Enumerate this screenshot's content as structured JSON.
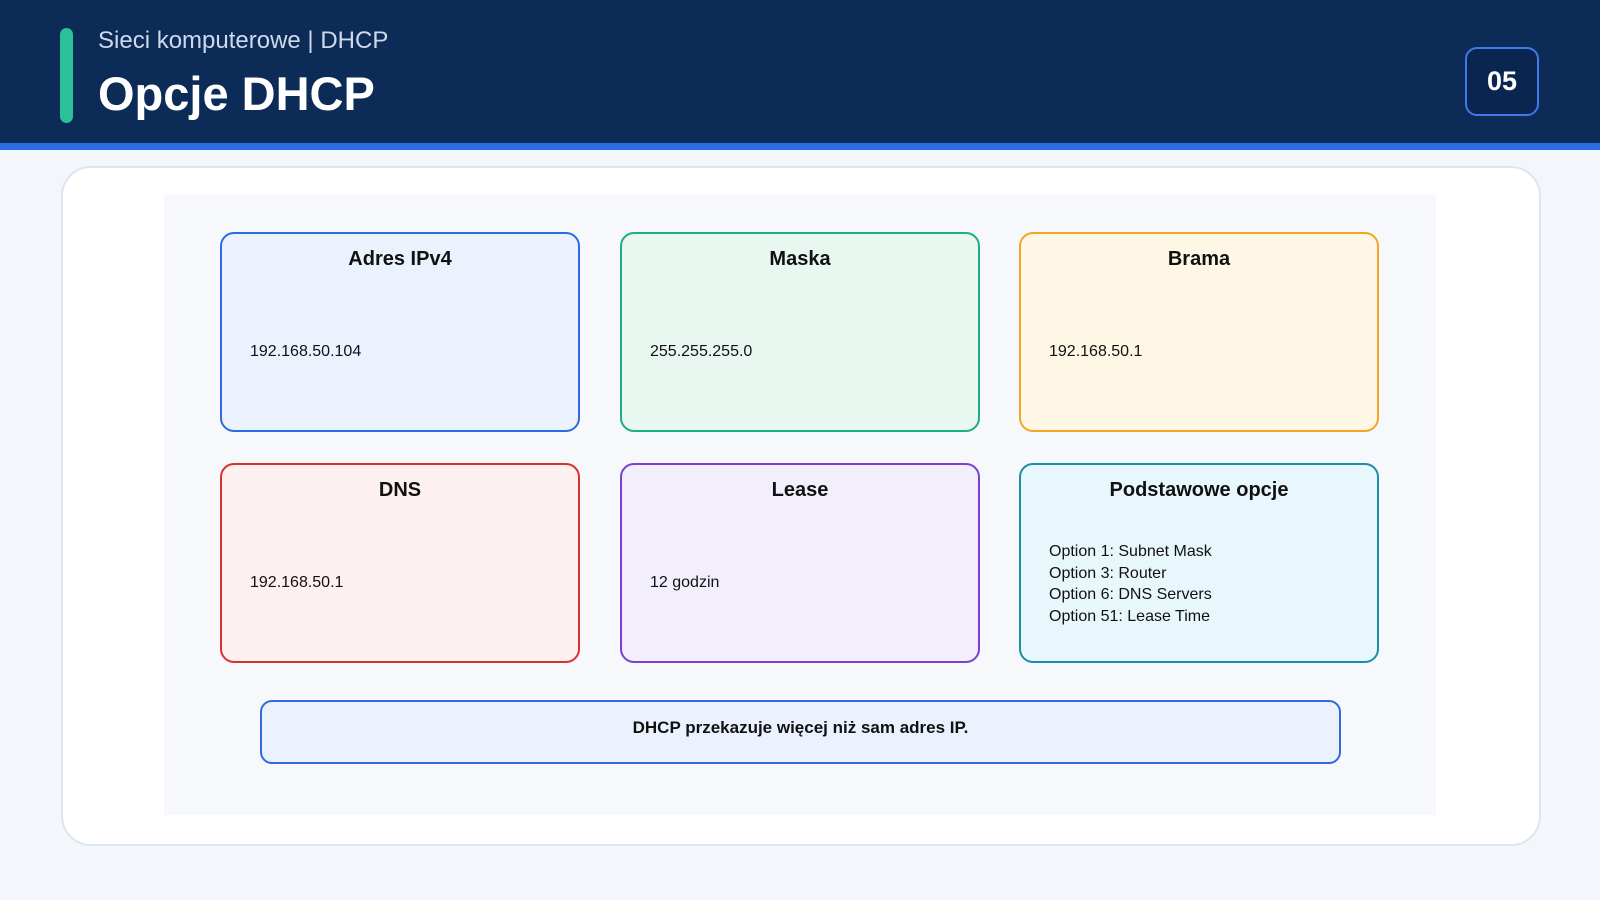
{
  "header": {
    "subtitle": "Sieci komputerowe | DHCP",
    "title": "Opcje DHCP",
    "slide_number": "05",
    "accent_color": "#2bbf9a"
  },
  "boxes": [
    {
      "title": "Adres IPv4",
      "value": "192.168.50.104",
      "border_color": "#2b6cde",
      "fill_color": "#ebf2fe"
    },
    {
      "title": "Maska",
      "value": "255.255.255.0",
      "border_color": "#1fae84",
      "fill_color": "#e8f7f0"
    },
    {
      "title": "Brama",
      "value": "192.168.50.1",
      "border_color": "#f5a524",
      "fill_color": "#fff7e6"
    },
    {
      "title": "DNS",
      "value": "192.168.50.1",
      "border_color": "#d9302c",
      "fill_color": "#fdf0f0"
    },
    {
      "title": "Lease",
      "value": "12 godzin",
      "border_color": "#7c3fd6",
      "fill_color": "#f3eefc"
    },
    {
      "title": "Podstawowe opcje",
      "options": [
        "Option 1: Subnet Mask",
        "Option 3: Router",
        "Option 6: DNS Servers",
        "Option 51: Lease Time"
      ],
      "border_color": "#1b8fa8",
      "fill_color": "#e8f7fb"
    }
  ],
  "note": "DHCP przekazuje więcej niż sam adres IP."
}
